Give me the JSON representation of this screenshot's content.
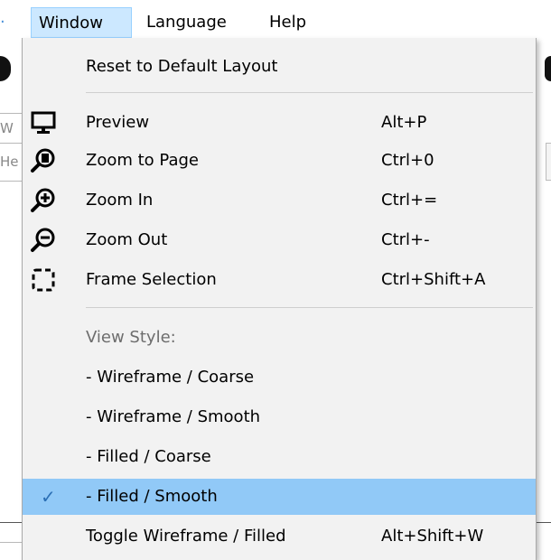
{
  "menubar": {
    "items": [
      {
        "label": "Window"
      },
      {
        "label": "Language"
      },
      {
        "label": "Help"
      }
    ]
  },
  "background": {
    "fragment_1": "W",
    "fragment_2": "He"
  },
  "menu": {
    "reset": {
      "label": "Reset to Default Layout"
    },
    "preview": {
      "label": "Preview",
      "shortcut": "Alt+P",
      "icon": "monitor-icon"
    },
    "zoom_page": {
      "label": "Zoom to Page",
      "shortcut": "Ctrl+0",
      "icon": "zoom-to-page-icon"
    },
    "zoom_in": {
      "label": "Zoom In",
      "shortcut": "Ctrl+=",
      "icon": "zoom-in-icon"
    },
    "zoom_out": {
      "label": "Zoom Out",
      "shortcut": "Ctrl+-",
      "icon": "zoom-out-icon"
    },
    "frame_selection": {
      "label": "Frame Selection",
      "shortcut": "Ctrl+Shift+A",
      "icon": "frame-selection-icon"
    },
    "view_style_header": {
      "label": "View Style:"
    },
    "styles": [
      {
        "label": "- Wireframe / Coarse",
        "checked": false
      },
      {
        "label": "- Wireframe / Smooth",
        "checked": false
      },
      {
        "label": "- Filled / Coarse",
        "checked": false
      },
      {
        "label": "- Filled / Smooth",
        "checked": true
      }
    ],
    "toggle": {
      "label": "Toggle Wireframe / Filled",
      "shortcut": "Alt+Shift+W"
    }
  },
  "colors": {
    "highlight": "#91c9f7",
    "menu_bg": "#f2f2f2",
    "active_menubar": "#cce8ff",
    "checkmark": "#2b6fb5"
  }
}
